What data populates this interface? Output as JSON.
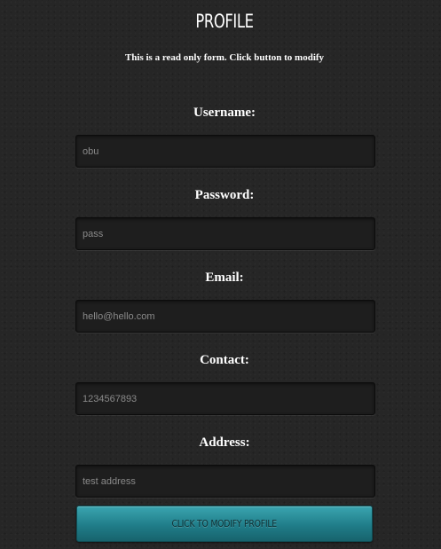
{
  "header": {
    "title": "PROFILE",
    "subtitle": "This is a read only form. Click button to modify"
  },
  "form": {
    "fields": [
      {
        "label": "Username:",
        "value": "obu"
      },
      {
        "label": "Password:",
        "value": "pass"
      },
      {
        "label": "Email:",
        "value": "hello@hello.com"
      },
      {
        "label": "Contact:",
        "value": "1234567893"
      },
      {
        "label": "Address:",
        "value": "test address"
      }
    ],
    "modify_button_label": "CLICK TO MODIFY PROFILE"
  },
  "colors": {
    "background": "#262626",
    "input_background": "#1e1e1e",
    "button_accent": "#207d89"
  }
}
